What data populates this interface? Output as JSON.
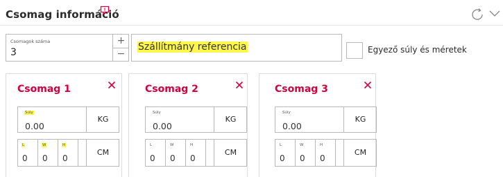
{
  "header": {
    "title": "Csomag információ"
  },
  "package_count": {
    "label": "Csomagok száma",
    "value": "3",
    "increment": "+",
    "decrement": "−"
  },
  "reference": {
    "text": "Szállítmány referencia"
  },
  "same_weight": {
    "label": "Egyező súly és méretek",
    "checked": false
  },
  "packages": [
    {
      "title": "Csomag 1",
      "weight_label": "Súly",
      "weight_value": "0.00",
      "weight_unit": "KG",
      "dims": [
        {
          "label": "L",
          "value": "0"
        },
        {
          "label": "W",
          "value": "0"
        },
        {
          "label": "H",
          "value": "0"
        }
      ],
      "dim_unit": "CM"
    },
    {
      "title": "Csomag 2",
      "weight_label": "Súly",
      "weight_value": "0.00",
      "weight_unit": "KG",
      "dims": [
        {
          "label": "L",
          "value": "0"
        },
        {
          "label": "W",
          "value": "0"
        },
        {
          "label": "H",
          "value": "0"
        }
      ],
      "dim_unit": "CM"
    },
    {
      "title": "Csomag 3",
      "weight_label": "Súly",
      "weight_value": "0.00",
      "weight_unit": "KG",
      "dims": [
        {
          "label": "L",
          "value": "0"
        },
        {
          "label": "W",
          "value": "0"
        },
        {
          "label": "H",
          "value": "0"
        }
      ],
      "dim_unit": "CM"
    }
  ],
  "colors": {
    "accent": "#d3003f",
    "highlight": "#fdf64b",
    "border": "#b9b9b9"
  },
  "icons": {
    "title": "comment-icon",
    "refresh": "refresh-icon",
    "collapse": "chevron-down-icon",
    "close": "close-icon"
  }
}
